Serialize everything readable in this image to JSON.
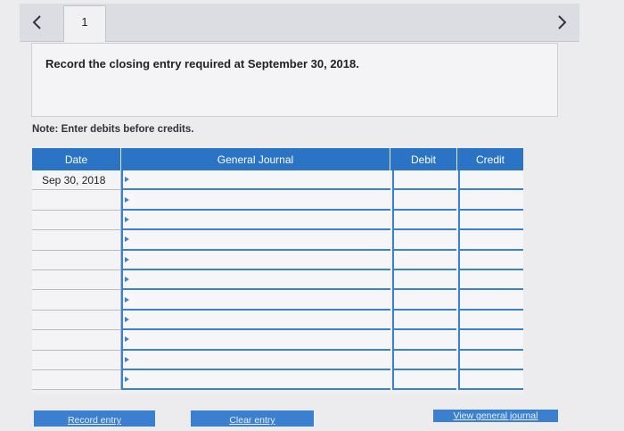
{
  "navigation": {
    "prev_icon": "chevron-left-icon",
    "next_icon": "chevron-right-icon",
    "tabs": [
      {
        "label": "1"
      }
    ]
  },
  "question": {
    "text": "Record the closing entry required at September 30, 2018."
  },
  "note": "Note: Enter debits before credits.",
  "journal": {
    "columns": {
      "date": "Date",
      "general_journal": "General Journal",
      "debit": "Debit",
      "credit": "Credit"
    },
    "rows": [
      {
        "date": "Sep 30, 2018",
        "account": "",
        "debit": "",
        "credit": ""
      },
      {
        "date": "",
        "account": "",
        "debit": "",
        "credit": ""
      },
      {
        "date": "",
        "account": "",
        "debit": "",
        "credit": ""
      },
      {
        "date": "",
        "account": "",
        "debit": "",
        "credit": ""
      },
      {
        "date": "",
        "account": "",
        "debit": "",
        "credit": ""
      },
      {
        "date": "",
        "account": "",
        "debit": "",
        "credit": ""
      },
      {
        "date": "",
        "account": "",
        "debit": "",
        "credit": ""
      },
      {
        "date": "",
        "account": "",
        "debit": "",
        "credit": ""
      },
      {
        "date": "",
        "account": "",
        "debit": "",
        "credit": ""
      },
      {
        "date": "",
        "account": "",
        "debit": "",
        "credit": ""
      },
      {
        "date": "",
        "account": "",
        "debit": "",
        "credit": ""
      }
    ]
  },
  "buttons": {
    "record": "Record entry",
    "clear": "Clear entry",
    "view": "View general journal"
  },
  "colors": {
    "accent": "#2a73c5",
    "grid_line": "#3a82cf"
  }
}
